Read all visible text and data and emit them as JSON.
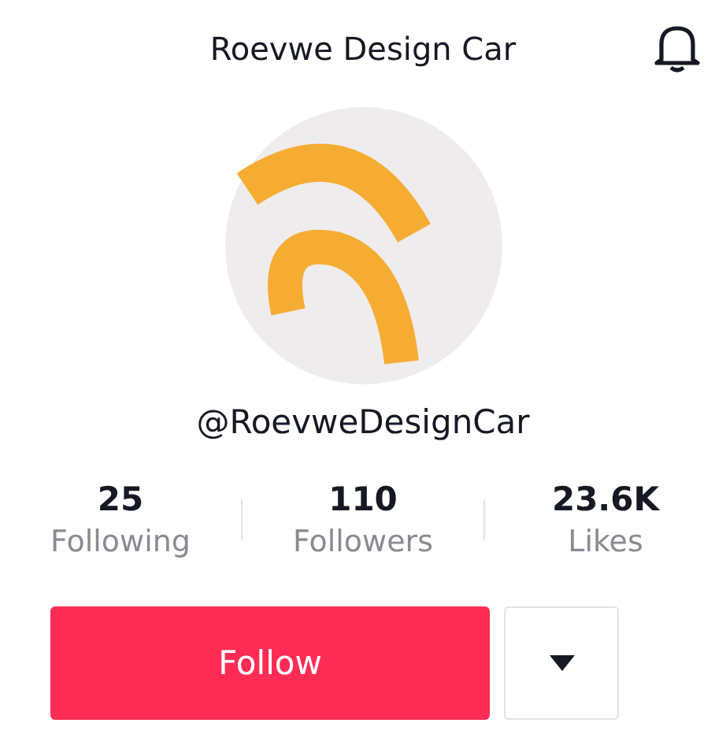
{
  "header": {
    "title": "Roevwe Design Car"
  },
  "profile": {
    "handle": "@RoevweDesignCar"
  },
  "stats": [
    {
      "value": "25",
      "label": "Following"
    },
    {
      "value": "110",
      "label": "Followers"
    },
    {
      "value": "23.6K",
      "label": "Likes"
    }
  ],
  "actions": {
    "follow": "Follow"
  }
}
